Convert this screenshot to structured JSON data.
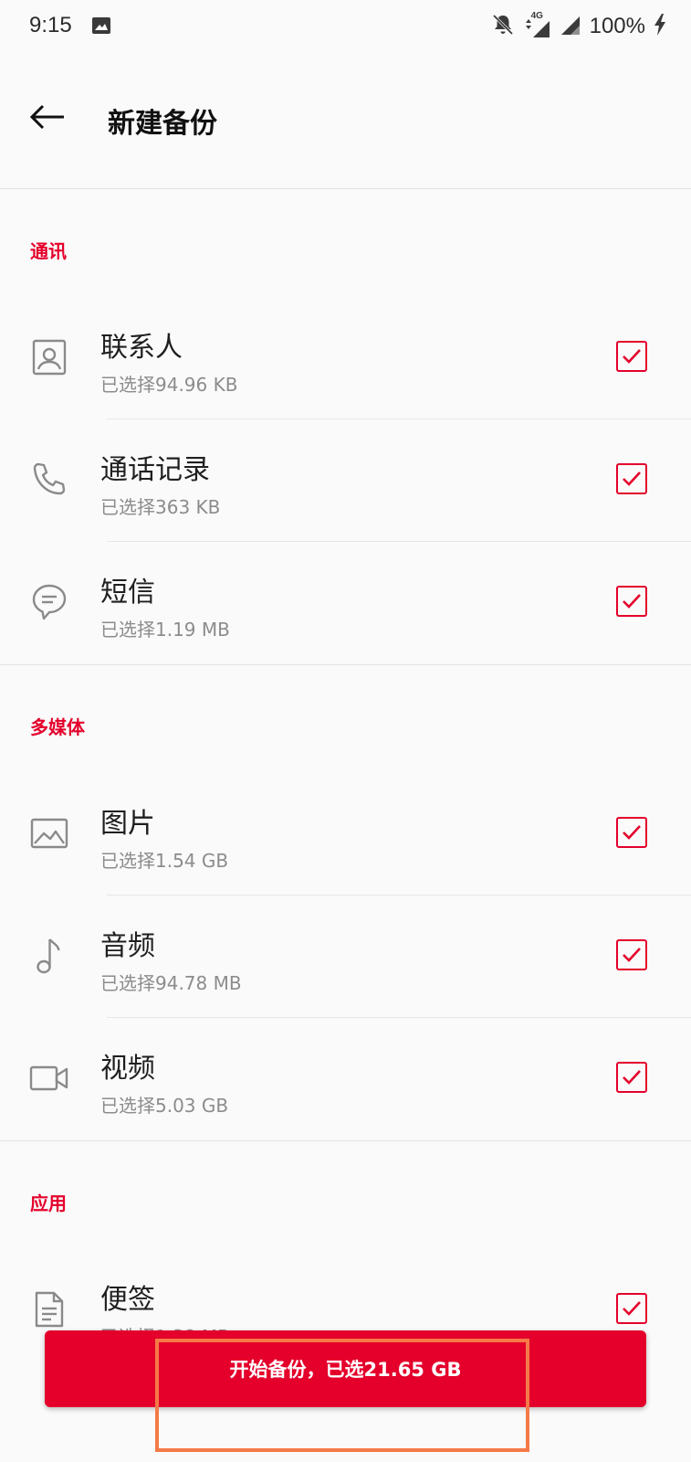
{
  "status_bar": {
    "time": "9:15",
    "battery": "100%",
    "network": "4G",
    "icons": [
      "image-icon",
      "bell-off-icon",
      "signal-icon",
      "battery-charging-icon"
    ]
  },
  "app_bar": {
    "title": "新建备份",
    "back_icon": "arrow-back-icon"
  },
  "sections": [
    {
      "title": "通讯",
      "items": [
        {
          "id": "contacts",
          "label": "联系人",
          "size": "已选择94.96 KB",
          "icon": "contact-icon",
          "checked": true
        },
        {
          "id": "call-log",
          "label": "通话记录",
          "size": "已选择363 KB",
          "icon": "phone-icon",
          "checked": true
        },
        {
          "id": "sms",
          "label": "短信",
          "size": "已选择1.19 MB",
          "icon": "message-icon",
          "checked": true
        }
      ]
    },
    {
      "title": "多媒体",
      "items": [
        {
          "id": "photos",
          "label": "图片",
          "size": "已选择1.54 GB",
          "icon": "image-icon",
          "checked": true
        },
        {
          "id": "audio",
          "label": "音频",
          "size": "已选择94.78 MB",
          "icon": "music-note-icon",
          "checked": true
        },
        {
          "id": "video",
          "label": "视频",
          "size": "已选择5.03 GB",
          "icon": "video-camera-icon",
          "checked": true
        }
      ]
    },
    {
      "title": "应用",
      "items": [
        {
          "id": "notes",
          "label": "便签",
          "size": "已选择1.38 MB",
          "icon": "note-icon",
          "checked": true
        }
      ]
    }
  ],
  "start_button": {
    "label": "开始备份，已选21.65 GB"
  },
  "colors": {
    "accent": "#e4002b",
    "background": "#fafafa",
    "subtitle": "#8c8c8c",
    "icon": "#8a8a8a",
    "highlight": "#f57a47"
  }
}
